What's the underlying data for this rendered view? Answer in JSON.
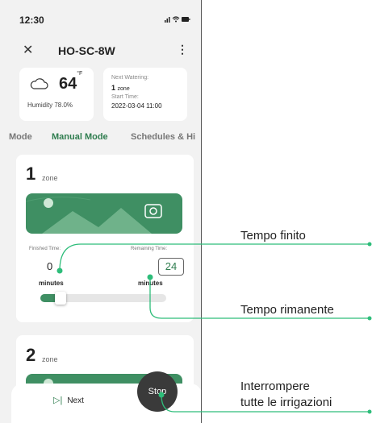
{
  "status_bar": {
    "time": "12:30",
    "icons": "… ◠ ▬"
  },
  "header": {
    "close": "✕",
    "title": "HO-SC-8W",
    "more": "⋮"
  },
  "weather": {
    "icon": "cloud-icon",
    "temperature": "64",
    "unit": "°F",
    "humidity_label": "Humidity",
    "humidity_value": "78.0%"
  },
  "watering": {
    "next_label": "Next Watering:",
    "next_value": "1",
    "next_unit": "zone",
    "start_label": "Start Time:",
    "start_value": "2022-03-04 11:00"
  },
  "tabs": [
    "Mode",
    "Manual Mode",
    "Schedules & Hi"
  ],
  "active_tab": "Manual Mode",
  "zone1": {
    "number": "1",
    "label": "zone",
    "finished_label": "Finished Time:",
    "finished_value": "0",
    "finished_unit": "minutes",
    "remaining_label": "Remaining Time:",
    "remaining_value": "24",
    "remaining_unit": "minutes",
    "progress": 0.1
  },
  "zone2": {
    "number": "2",
    "label": "zone"
  },
  "bottom": {
    "next_icon": "skip-next-icon",
    "next_label": "Next",
    "stop_label": "Stop"
  },
  "callouts": {
    "finished": "Tempo finito",
    "remaining": "Tempo rimanente",
    "stop_line1": "Interrompere",
    "stop_line2": "tutte le irrigazioni"
  },
  "colors": {
    "accent": "#3f8f63",
    "callout_line": "#2ebd7a"
  }
}
